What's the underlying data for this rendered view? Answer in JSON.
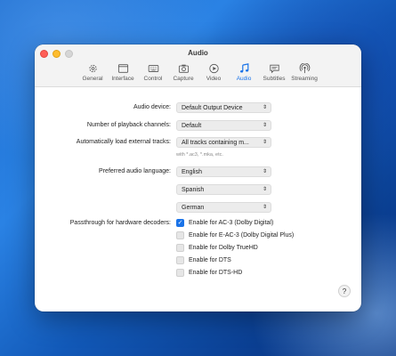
{
  "window": {
    "title": "Audio"
  },
  "tabs": [
    {
      "label": "General",
      "icon": "gear-icon"
    },
    {
      "label": "Interface",
      "icon": "window-icon"
    },
    {
      "label": "Control",
      "icon": "keyboard-icon"
    },
    {
      "label": "Capture",
      "icon": "camera-icon"
    },
    {
      "label": "Video",
      "icon": "play-icon"
    },
    {
      "label": "Audio",
      "icon": "music-note-icon",
      "active": true
    },
    {
      "label": "Subtitles",
      "icon": "speech-bubble-icon"
    },
    {
      "label": "Streaming",
      "icon": "broadcast-icon"
    }
  ],
  "settings": {
    "audio_device": {
      "label": "Audio device:",
      "value": "Default Output Device"
    },
    "channels": {
      "label": "Number of playback channels:",
      "value": "Default"
    },
    "external_tracks": {
      "label": "Automatically load external tracks:",
      "value": "All tracks containing m...",
      "hint": "with *.ac3, *.mka, etc."
    },
    "preferred_language": {
      "label": "Preferred audio language:",
      "values": [
        "English",
        "Spanish",
        "German"
      ]
    },
    "passthrough": {
      "label": "Passthrough for hardware decoders:",
      "options": [
        {
          "label": "Enable for AC-3 (Dolby Digital)",
          "checked": true
        },
        {
          "label": "Enable for E-AC-3 (Dolby Digital Plus)",
          "checked": false
        },
        {
          "label": "Enable for Dolby TrueHD",
          "checked": false
        },
        {
          "label": "Enable for DTS",
          "checked": false
        },
        {
          "label": "Enable for DTS-HD",
          "checked": false
        }
      ]
    }
  },
  "help": {
    "label": "?"
  },
  "colors": {
    "accent": "#1a73e8",
    "traffic_red": "#ff5f57",
    "traffic_yellow": "#febc2e"
  }
}
